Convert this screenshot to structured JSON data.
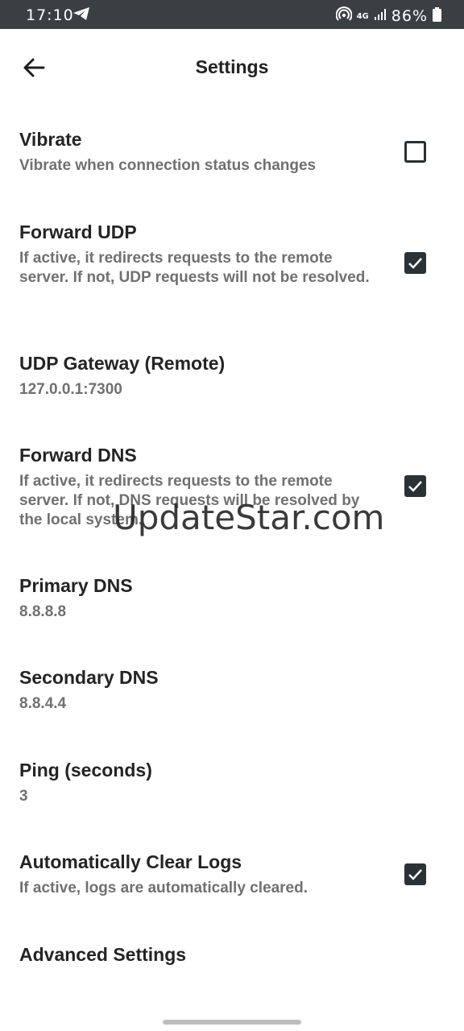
{
  "status_bar": {
    "time": "17:10",
    "network": "4G",
    "battery": "86%"
  },
  "header": {
    "title": "Settings"
  },
  "settings": {
    "vibrate": {
      "title": "Vibrate",
      "subtitle": "Vibrate when connection status changes",
      "checked": false
    },
    "forward_udp": {
      "title": "Forward UDP",
      "subtitle": "If active, it redirects requests to the remote server. If not, UDP requests will not be resolved.",
      "checked": true
    },
    "udp_gateway": {
      "title": "UDP Gateway (Remote)",
      "value": "127.0.0.1:7300"
    },
    "forward_dns": {
      "title": "Forward DNS",
      "subtitle": "If active, it redirects requests to the remote server. If not, DNS requests will be resolved by the local system.",
      "checked": true
    },
    "primary_dns": {
      "title": "Primary DNS",
      "value": "8.8.8.8"
    },
    "secondary_dns": {
      "title": "Secondary DNS",
      "value": "8.8.4.4"
    },
    "ping": {
      "title": "Ping (seconds)",
      "value": "3"
    },
    "auto_clear_logs": {
      "title": "Automatically Clear Logs",
      "subtitle": "If active, logs are automatically cleared.",
      "checked": true
    },
    "advanced": {
      "title": "Advanced Settings"
    }
  },
  "watermark": "UpdateStar.com",
  "colors": {
    "status_bar": "#3a3f42",
    "checkbox": "#2b3236",
    "subtitle": "#707070"
  }
}
